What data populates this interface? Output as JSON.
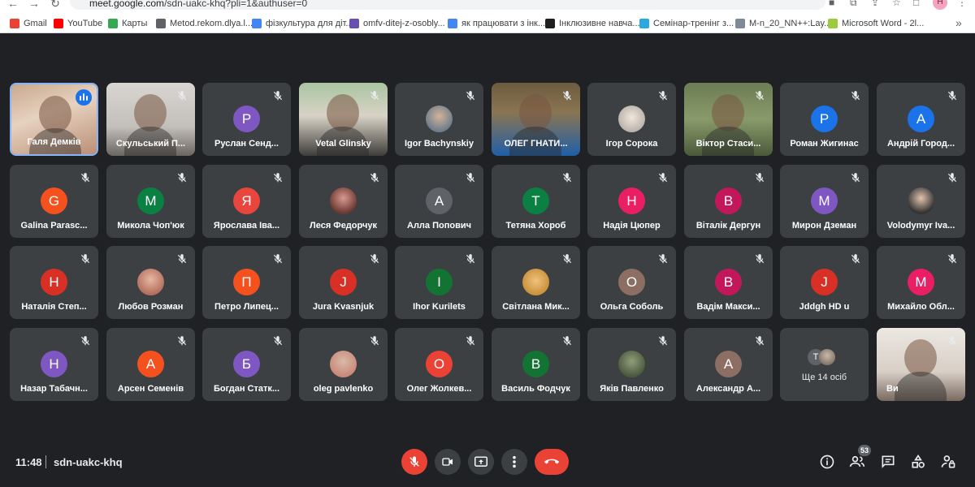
{
  "browser": {
    "url_host": "meet.google.com",
    "url_path": "/sdn-uakc-khq?pli=1&authuser=0",
    "profile_initial": "Н",
    "bookmarks": [
      {
        "label": "Gmail",
        "color": "#ea4335"
      },
      {
        "label": "YouTube",
        "color": "#ff0000"
      },
      {
        "label": "Карты",
        "color": "#34a853"
      },
      {
        "label": "Metod.rekom.dlya.l...",
        "color": "#5f6368"
      },
      {
        "label": "фізкультура для діт...",
        "color": "#4285f4"
      },
      {
        "label": "omfv-ditej-z-osobly...",
        "color": "#6a4fb3"
      },
      {
        "label": "як працювати з інк...",
        "color": "#4285f4"
      },
      {
        "label": "Інклюзивне навча...",
        "color": "#1f1f1f"
      },
      {
        "label": "Семінар-тренінг з...",
        "color": "#2aa8e0"
      },
      {
        "label": "M-n_20_NN++:Lay...",
        "color": "#7e8a97"
      },
      {
        "label": "Microsoft Word - 2l...",
        "color": "#9ccc3a"
      }
    ],
    "bookmarks_more": "»"
  },
  "participants": [
    {
      "name": "Галя Демків",
      "type": "video",
      "speaking": true
    },
    {
      "name": "Скульський П...",
      "type": "video"
    },
    {
      "name": "Руслан Сенд...",
      "type": "initial",
      "initial": "Р",
      "color": "#7e57c2"
    },
    {
      "name": "Vetal Glinsky",
      "type": "video"
    },
    {
      "name": "Igor Bachynskiy",
      "type": "photo"
    },
    {
      "name": "ОЛЕГ ГНАТИ...",
      "type": "video"
    },
    {
      "name": "Ігор Сорока",
      "type": "photo"
    },
    {
      "name": "Віктор Стаси...",
      "type": "video"
    },
    {
      "name": "Роман Жигинас",
      "type": "initial",
      "initial": "Р",
      "color": "#1a73e8"
    },
    {
      "name": "Андрій Город...",
      "type": "initial",
      "initial": "А",
      "color": "#1a73e8"
    },
    {
      "name": "Galina Parasc...",
      "type": "initial",
      "initial": "G",
      "color": "#f4511e"
    },
    {
      "name": "Микола Чоп'юк",
      "type": "initial",
      "initial": "М",
      "color": "#0b8043"
    },
    {
      "name": "Ярослава Іва...",
      "type": "initial",
      "initial": "Я",
      "color": "#e8453c"
    },
    {
      "name": "Леся Федорчук",
      "type": "photo"
    },
    {
      "name": "Алла Попович",
      "type": "initial",
      "initial": "А",
      "color": "#5f6368"
    },
    {
      "name": "Тетяна Хороб",
      "type": "initial",
      "initial": "Т",
      "color": "#0b8043"
    },
    {
      "name": "Надія Цюпер",
      "type": "initial",
      "initial": "Н",
      "color": "#e91e63"
    },
    {
      "name": "Віталік Дергун",
      "type": "initial",
      "initial": "В",
      "color": "#c2185b"
    },
    {
      "name": "Мирон Дземан",
      "type": "initial",
      "initial": "М",
      "color": "#7e57c2"
    },
    {
      "name": "Volodymyr Iva...",
      "type": "photo"
    },
    {
      "name": "Наталія Степ...",
      "type": "initial",
      "initial": "Н",
      "color": "#d93025"
    },
    {
      "name": "Любов Розман",
      "type": "photo"
    },
    {
      "name": "Петро Липец...",
      "type": "initial",
      "initial": "П",
      "color": "#f4511e"
    },
    {
      "name": "Jura Kvasnjuk",
      "type": "initial",
      "initial": "J",
      "color": "#d93025"
    },
    {
      "name": "Ihor Kurilets",
      "type": "initial",
      "initial": "I",
      "color": "#137333"
    },
    {
      "name": "Світлана Мик...",
      "type": "photo"
    },
    {
      "name": "Ольга Соболь",
      "type": "initial",
      "initial": "О",
      "color": "#8d6e63"
    },
    {
      "name": "Вадім Макси...",
      "type": "initial",
      "initial": "В",
      "color": "#c2185b"
    },
    {
      "name": "Jddgh HD u",
      "type": "initial",
      "initial": "J",
      "color": "#d93025"
    },
    {
      "name": "Михайло Обл...",
      "type": "initial",
      "initial": "М",
      "color": "#e91e63"
    },
    {
      "name": "Назар Табачн...",
      "type": "initial",
      "initial": "Н",
      "color": "#7e57c2"
    },
    {
      "name": "Арсен Семенів",
      "type": "initial",
      "initial": "А",
      "color": "#f4511e"
    },
    {
      "name": "Богдан Статк...",
      "type": "initial",
      "initial": "Б",
      "color": "#7e57c2"
    },
    {
      "name": "oleg pavlenko",
      "type": "photo"
    },
    {
      "name": "Олег Жолкев...",
      "type": "initial",
      "initial": "О",
      "color": "#ea4335"
    },
    {
      "name": "Василь Фодчук",
      "type": "initial",
      "initial": "В",
      "color": "#137333"
    },
    {
      "name": "Яків Павленко",
      "type": "photo"
    },
    {
      "name": "Александр А...",
      "type": "initial",
      "initial": "А",
      "color": "#8d6e63"
    },
    {
      "name": "Ще 14 осіб",
      "type": "more",
      "initial": "Т"
    },
    {
      "name": "Ви",
      "type": "video"
    }
  ],
  "bottom": {
    "time": "11:48",
    "meeting_code": "sdn-uakc-khq",
    "people_count": "53"
  }
}
